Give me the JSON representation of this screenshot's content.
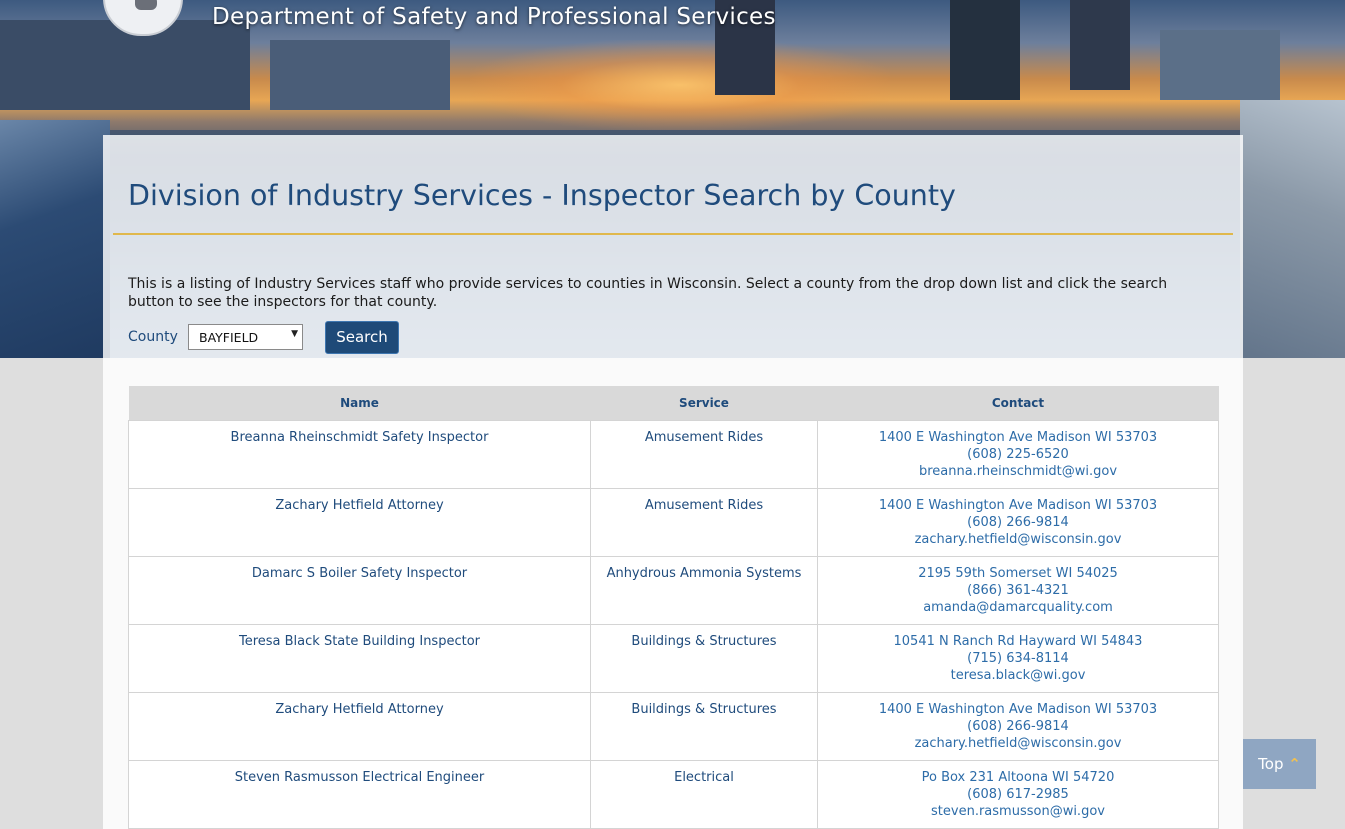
{
  "header": {
    "department": "Department of Safety and Professional Services",
    "logo_icon": "state-seal-icon"
  },
  "page": {
    "title": "Division of Industry Services - Inspector Search by County",
    "intro": "This is a listing of Industry Services staff who provide services to counties in Wisconsin. Select a county from the drop down list and click the search button to see the inspectors for that county."
  },
  "form": {
    "county_label": "County",
    "county_value": "BAYFIELD",
    "search_label": "Search"
  },
  "table": {
    "headers": [
      "Name",
      "Service",
      "Contact"
    ],
    "rows": [
      {
        "name": "Breanna Rheinschmidt Safety Inspector",
        "service": "Amusement Rides",
        "address": "1400 E Washington Ave Madison WI 53703",
        "phone": "(608) 225-6520",
        "email": "breanna.rheinschmidt@wi.gov"
      },
      {
        "name": "Zachary Hetfield Attorney",
        "service": "Amusement Rides",
        "address": "1400 E Washington Ave Madison WI 53703",
        "phone": "(608) 266-9814",
        "email": "zachary.hetfield@wisconsin.gov"
      },
      {
        "name": "Damarc S Boiler Safety Inspector",
        "service": "Anhydrous Ammonia Systems",
        "address": "2195 59th Somerset WI 54025",
        "phone": "(866) 361-4321",
        "email": "amanda@damarcquality.com"
      },
      {
        "name": "Teresa Black State Building Inspector",
        "service": "Buildings & Structures",
        "address": "10541 N Ranch Rd Hayward WI 54843",
        "phone": "(715) 634-8114",
        "email": "teresa.black@wi.gov"
      },
      {
        "name": "Zachary Hetfield Attorney",
        "service": "Buildings & Structures",
        "address": "1400 E Washington Ave Madison WI 53703",
        "phone": "(608) 266-9814",
        "email": "zachary.hetfield@wisconsin.gov"
      },
      {
        "name": "Steven Rasmusson Electrical Engineer",
        "service": "Electrical",
        "address": "Po Box 231 Altoona WI 54720",
        "phone": "(608) 617-2985",
        "email": "steven.rasmusson@wi.gov"
      }
    ]
  },
  "back_to_top": {
    "label": "Top",
    "icon": "chevron-up-icon",
    "accent_color": "#f2c14e"
  }
}
